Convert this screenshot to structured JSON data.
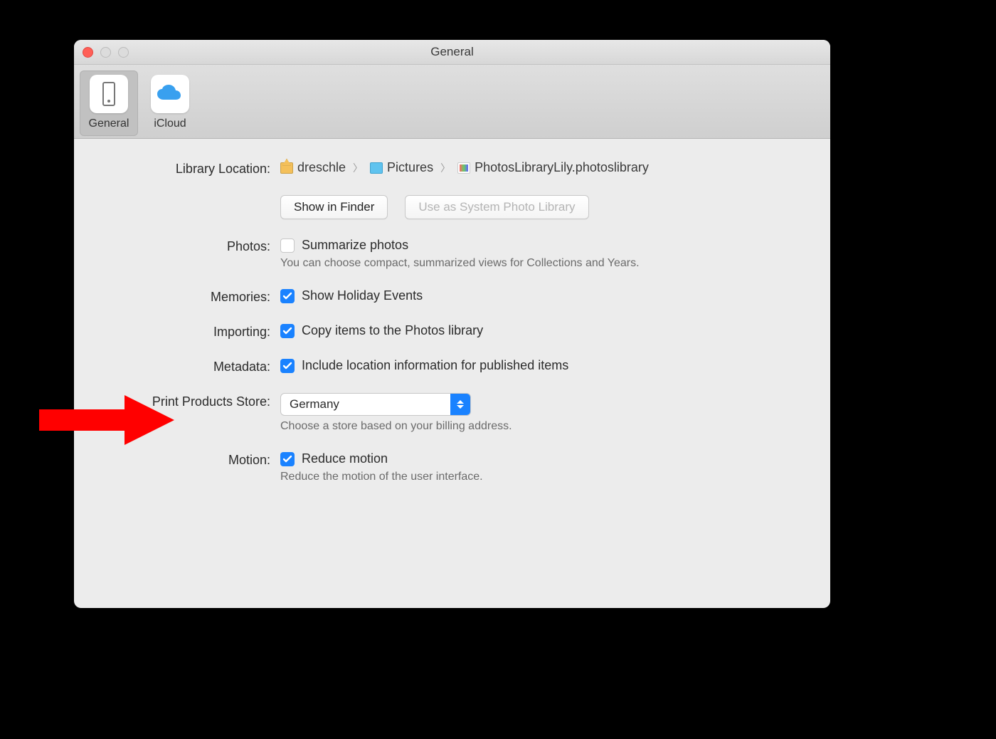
{
  "window": {
    "title": "General"
  },
  "tabs": {
    "general": "General",
    "icloud": "iCloud"
  },
  "labels": {
    "library_location": "Library Location:",
    "photos": "Photos:",
    "memories": "Memories:",
    "importing": "Importing:",
    "metadata": "Metadata:",
    "print_store": "Print Products Store:",
    "motion": "Motion:"
  },
  "breadcrumb": {
    "seg1": "dreschle",
    "seg2": "Pictures",
    "seg3": "PhotosLibraryLily.photoslibrary"
  },
  "buttons": {
    "show_in_finder": "Show in Finder",
    "use_system_library": "Use as System Photo Library"
  },
  "photos": {
    "summarize": "Summarize photos",
    "hint": "You can choose compact, summarized views for Collections and Years."
  },
  "memories": {
    "holiday": "Show Holiday Events"
  },
  "importing": {
    "copy": "Copy items to the Photos library"
  },
  "metadata": {
    "location": "Include location information for published items"
  },
  "print_store": {
    "value": "Germany",
    "hint": "Choose a store based on your billing address."
  },
  "motion": {
    "reduce": "Reduce motion",
    "hint": "Reduce the motion of the user interface."
  }
}
